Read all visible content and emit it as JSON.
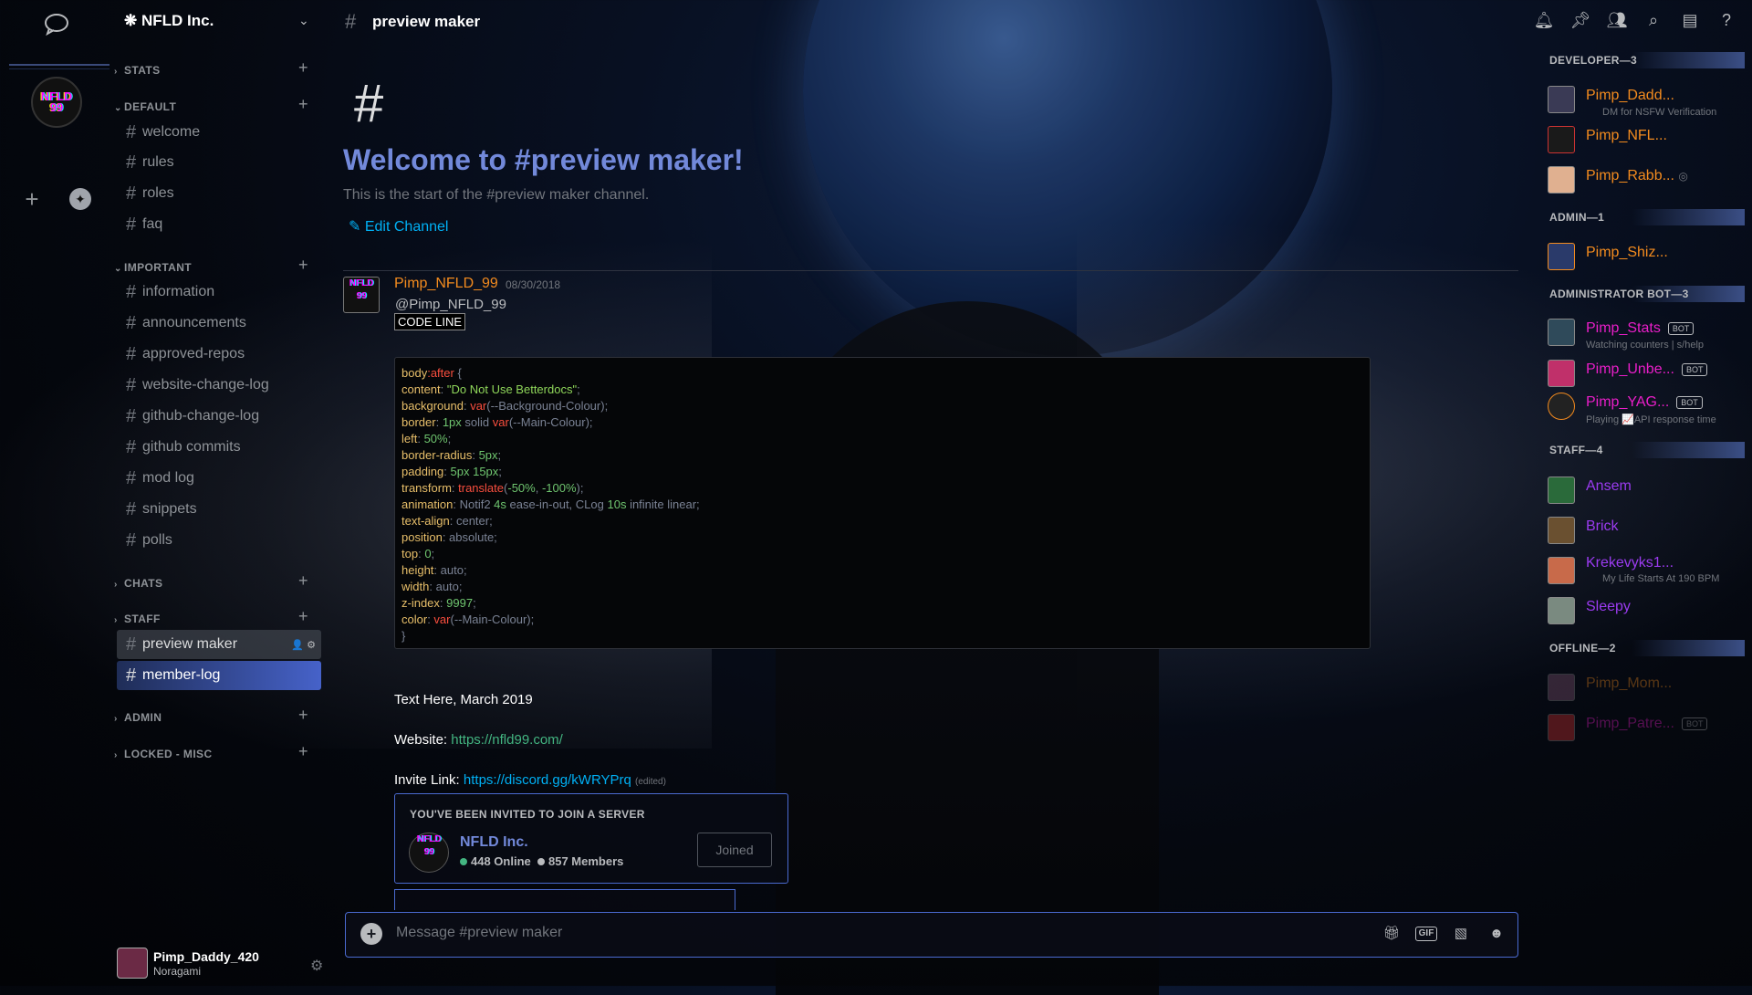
{
  "server": {
    "name": "NFLD Inc.",
    "chevron_icon": "chevron-down-icon"
  },
  "guild_bar": {
    "avatar_text": "NFLD 99",
    "add_label": "+",
    "explore_icon": "compass-icon"
  },
  "categories": {
    "stats": "STATS",
    "default": "DEFAULT",
    "important": "IMPORTANT",
    "chats": "CHATS",
    "staff": "STAFF",
    "admin": "ADMIN",
    "locked": "LOCKED - MISC"
  },
  "channels": {
    "welcome": "welcome",
    "rules": "rules",
    "roles": "roles",
    "faq": "faq",
    "information": "information",
    "announcements": "announcements",
    "approved_repos": "approved-repos",
    "website_change_log": "website-change-log",
    "github_change_log": "github-change-log",
    "github_commits": "github commits",
    "mod_log": "mod log",
    "snippets": "snippets",
    "polls": "polls",
    "preview_maker": "preview maker",
    "member_log": "member-log"
  },
  "user": {
    "name": "Pimp_Daddy_420",
    "status": "Noragami"
  },
  "header": {
    "channel": "preview maker"
  },
  "welcome": {
    "hash": "#",
    "title": "Welcome to #preview maker!",
    "subtitle": "This is the start of the #preview maker channel.",
    "edit": "Edit Channel"
  },
  "message": {
    "author": "Pimp_NFLD_99",
    "timestamp": "08/30/2018",
    "mention": "@Pimp_NFLD_99",
    "code_line_label": "CODE LINE",
    "text_date": "Text Here, March 2019",
    "website_label": "Website:",
    "website_url": "https://nfld99.com/",
    "invite_label": "Invite Link:",
    "invite_url": "https://discord.gg/kWRYPrq",
    "edited": "(edited)"
  },
  "code": [
    "body:after {",
    "content: \"Do Not Use Betterdocs\";",
    "background: var(--Background-Colour);",
    "border: 1px solid var(--Main-Colour);",
    "left: 50%;",
    "border-radius: 5px;",
    "padding: 5px 15px;",
    "transform: translate(-50%, -100%);",
    "animation: Notif2 4s ease-in-out, CLog 10s infinite linear;",
    "text-align: center;",
    "position: absolute;",
    "top: 0;",
    "height: auto;",
    "width: auto;",
    "z-index: 9997;",
    "color: var(--Main-Colour);",
    "}"
  ],
  "invite": {
    "heading": "YOU'VE BEEN INVITED TO JOIN A SERVER",
    "server": "NFLD Inc.",
    "online": "448 Online",
    "members": "857 Members",
    "button": "Joined"
  },
  "chat": {
    "placeholder": "Message #preview maker",
    "gif": "GIF"
  },
  "members": {
    "developer": "DEVELOPER—3",
    "admin": "ADMIN—1",
    "admin_bot": "ADMINISTRATOR BOT—3",
    "staff": "STAFF—4",
    "offline": "OFFLINE—2",
    "list": [
      {
        "name": "Pimp_Dadd...",
        "sub": "DM for NSFW Verification",
        "color": "#f38b1e"
      },
      {
        "name": "Pimp_NFL...",
        "sub": "",
        "color": "#f38b1e"
      },
      {
        "name": "Pimp_Rabb...",
        "sub": "",
        "color": "#f38b1e"
      },
      {
        "name": "Pimp_Shiz...",
        "sub": "",
        "color": "#f38b1e"
      },
      {
        "name": "Pimp_Stats",
        "sub": "Watching counters | s/help",
        "color": "#e91ec8",
        "bot": "BOT"
      },
      {
        "name": "Pimp_Unbe...",
        "sub": "",
        "color": "#e91ec8",
        "bot": "BOT"
      },
      {
        "name": "Pimp_YAG...",
        "sub": "Playing 📈API response time",
        "color": "#e91ec8",
        "bot": "BOT"
      },
      {
        "name": "Ansem",
        "sub": "",
        "color": "#9b3bf0"
      },
      {
        "name": "Brick",
        "sub": "",
        "color": "#9b3bf0"
      },
      {
        "name": "Krekevyks1...",
        "sub": "My Life Starts At 190 BPM",
        "color": "#9b3bf0"
      },
      {
        "name": "Sleepy",
        "sub": "",
        "color": "#9b3bf0"
      },
      {
        "name": "Pimp_Mom...",
        "sub": "",
        "color": "#f38b1e"
      },
      {
        "name": "Pimp_Patre...",
        "sub": "",
        "color": "#e91ec8",
        "bot": "BOT"
      }
    ]
  },
  "colors": {
    "accent": "#7289da",
    "link": "#00b0f4",
    "online": "#43b581",
    "selection": "#4662c9"
  }
}
